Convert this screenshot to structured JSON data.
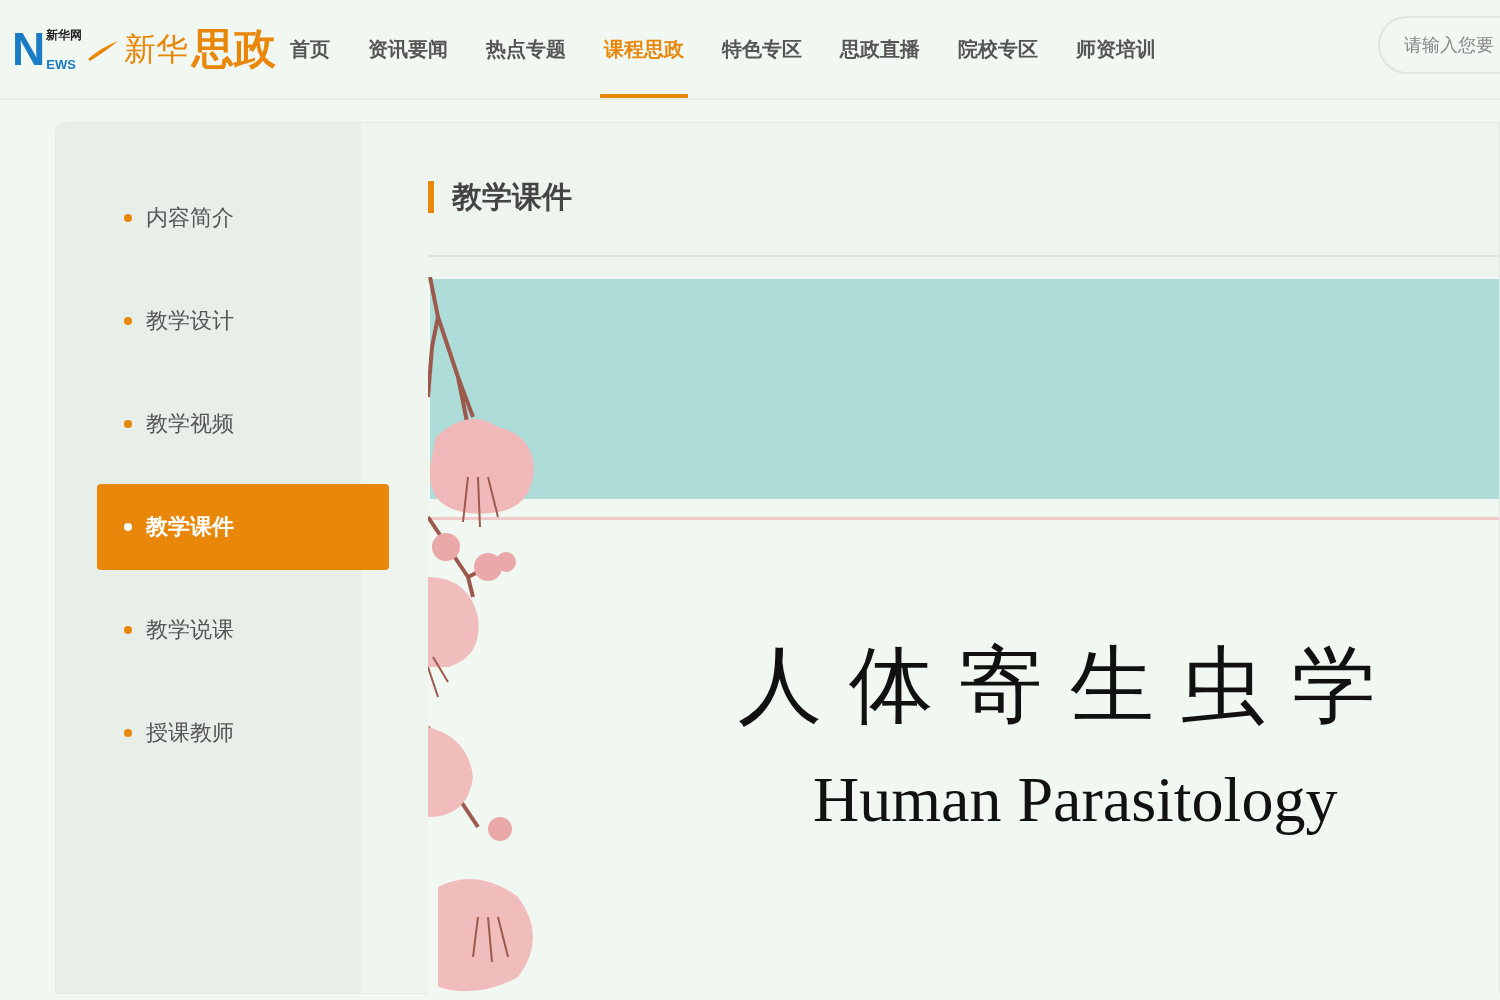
{
  "logo": {
    "site_name": "新华网",
    "letter": "N",
    "letters": "EWS",
    "brand": "新华",
    "brand_bold": "思政"
  },
  "nav": [
    {
      "label": "首页",
      "selected": false
    },
    {
      "label": "资讯要闻",
      "selected": false
    },
    {
      "label": "热点专题",
      "selected": false
    },
    {
      "label": "课程思政",
      "selected": true
    },
    {
      "label": "特色专区",
      "selected": false
    },
    {
      "label": "思政直播",
      "selected": false
    },
    {
      "label": "院校专区",
      "selected": false
    },
    {
      "label": "师资培训",
      "selected": false
    }
  ],
  "search": {
    "placeholder": "请输入您要"
  },
  "sidebar": {
    "items": [
      {
        "label": "内容简介",
        "selected": false
      },
      {
        "label": "教学设计",
        "selected": false
      },
      {
        "label": "教学视频",
        "selected": false
      },
      {
        "label": "教学课件",
        "selected": true
      },
      {
        "label": "教学说课",
        "selected": false
      },
      {
        "label": "授课教师",
        "selected": false
      }
    ]
  },
  "content": {
    "heading": "教学课件",
    "slide": {
      "title": "人 体 寄 生 虫 学",
      "subtitle": "Human Parasitology"
    }
  }
}
